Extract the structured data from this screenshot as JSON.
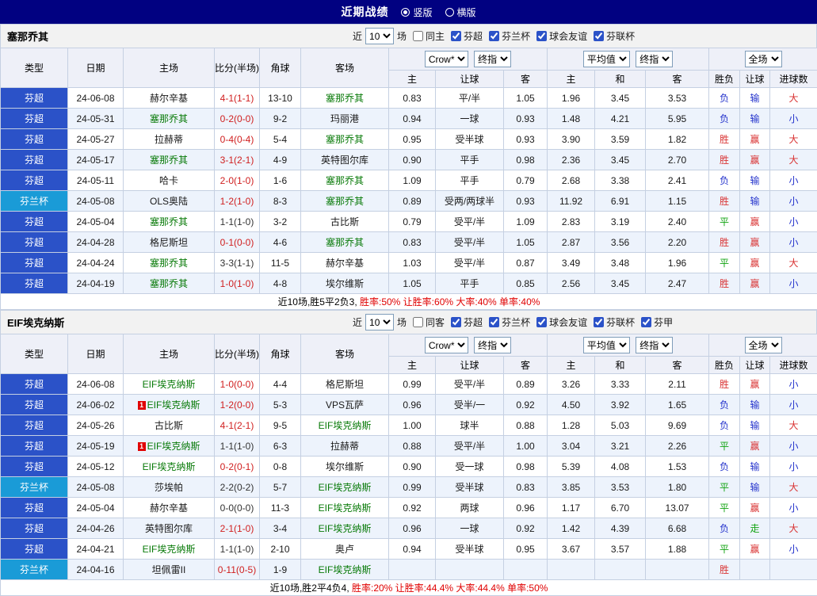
{
  "topbar": {
    "title": "近期战绩",
    "options": [
      {
        "label": "竖版",
        "selected": true
      },
      {
        "label": "横版",
        "selected": false
      }
    ]
  },
  "filter_labels": {
    "near": "近",
    "count": "10",
    "games": "场"
  },
  "odds_groups": {
    "book_select": "Crow*",
    "final_select": "终指",
    "avg_select": "平均值",
    "avg_final_select": "终指",
    "full_select": "全场"
  },
  "columns": {
    "type": "类型",
    "date": "日期",
    "home": "主场",
    "score": "比分(半场)",
    "corner": "角球",
    "away": "客场",
    "home_odds": "主",
    "handicap": "让球",
    "away_odds": "客",
    "avg_home": "主",
    "avg_draw": "和",
    "avg_away": "客",
    "result": "胜负",
    "handicap_result": "让球",
    "goals": "进球数"
  },
  "colors": {
    "topbar_bg": "#010181",
    "league_super": "#2b52c8",
    "league_cup": "#1a9bd7",
    "focus_team": "#087a08",
    "score_red": "#d02020",
    "score_dark": "#333333",
    "result_win": "#d93333",
    "result_draw": "#12a312",
    "result_lose": "#2433cc",
    "summary_stats": "#e00000",
    "red_card": "#e00000"
  },
  "sections": [
    {
      "team": "塞那乔其",
      "same_filter": "同主",
      "same_checked": false,
      "leagues": [
        {
          "label": "芬超",
          "checked": true
        },
        {
          "label": "芬兰杯",
          "checked": true
        },
        {
          "label": "球会友谊",
          "checked": true
        },
        {
          "label": "芬联杯",
          "checked": true
        }
      ],
      "summary_prefix": "近10场,胜5平2负3, ",
      "summary_stats": "胜率:50% 让胜率:60% 大率:40% 单率:40%",
      "rows": [
        {
          "league": "芬超",
          "league_type": "super",
          "date": "24-06-08",
          "home": "赫尔辛基",
          "home_focus": false,
          "home_redcard": "",
          "score": "4-1(1-1)",
          "score_style": "red",
          "corner": "13-10",
          "away": "塞那乔其",
          "away_focus": true,
          "odds": [
            "0.83",
            "平/半",
            "1.05",
            "1.96",
            "3.45",
            "3.53"
          ],
          "result": {
            "text": "负",
            "style": "lose"
          },
          "handicap_result": {
            "text": "输",
            "style": "lose"
          },
          "goals": {
            "text": "大",
            "style": "win"
          }
        },
        {
          "league": "芬超",
          "league_type": "super",
          "date": "24-05-31",
          "home": "塞那乔其",
          "home_focus": true,
          "home_redcard": "",
          "score": "0-2(0-0)",
          "score_style": "red",
          "corner": "9-2",
          "away": "玛丽港",
          "away_focus": false,
          "odds": [
            "0.94",
            "一球",
            "0.93",
            "1.48",
            "4.21",
            "5.95"
          ],
          "result": {
            "text": "负",
            "style": "lose"
          },
          "handicap_result": {
            "text": "输",
            "style": "lose"
          },
          "goals": {
            "text": "小",
            "style": "lose"
          }
        },
        {
          "league": "芬超",
          "league_type": "super",
          "date": "24-05-27",
          "home": "拉赫蒂",
          "home_focus": false,
          "home_redcard": "",
          "score": "0-4(0-4)",
          "score_style": "red",
          "corner": "5-4",
          "away": "塞那乔其",
          "away_focus": true,
          "odds": [
            "0.95",
            "受半球",
            "0.93",
            "3.90",
            "3.59",
            "1.82"
          ],
          "result": {
            "text": "胜",
            "style": "win"
          },
          "handicap_result": {
            "text": "赢",
            "style": "win"
          },
          "goals": {
            "text": "大",
            "style": "win"
          }
        },
        {
          "league": "芬超",
          "league_type": "super",
          "date": "24-05-17",
          "home": "塞那乔其",
          "home_focus": true,
          "home_redcard": "",
          "score": "3-1(2-1)",
          "score_style": "red",
          "corner": "4-9",
          "away": "英特图尔库",
          "away_focus": false,
          "odds": [
            "0.90",
            "平手",
            "0.98",
            "2.36",
            "3.45",
            "2.70"
          ],
          "result": {
            "text": "胜",
            "style": "win"
          },
          "handicap_result": {
            "text": "赢",
            "style": "win"
          },
          "goals": {
            "text": "大",
            "style": "win"
          }
        },
        {
          "league": "芬超",
          "league_type": "super",
          "date": "24-05-11",
          "home": "哈卡",
          "home_focus": false,
          "home_redcard": "",
          "score": "2-0(1-0)",
          "score_style": "red",
          "corner": "1-6",
          "away": "塞那乔其",
          "away_focus": true,
          "odds": [
            "1.09",
            "平手",
            "0.79",
            "2.68",
            "3.38",
            "2.41"
          ],
          "result": {
            "text": "负",
            "style": "lose"
          },
          "handicap_result": {
            "text": "输",
            "style": "lose"
          },
          "goals": {
            "text": "小",
            "style": "lose"
          }
        },
        {
          "league": "芬兰杯",
          "league_type": "cup",
          "date": "24-05-08",
          "home": "OLS奥陆",
          "home_focus": false,
          "home_redcard": "",
          "score": "1-2(1-0)",
          "score_style": "red",
          "corner": "8-3",
          "away": "塞那乔其",
          "away_focus": true,
          "odds": [
            "0.89",
            "受两/两球半",
            "0.93",
            "11.92",
            "6.91",
            "1.15"
          ],
          "result": {
            "text": "胜",
            "style": "win"
          },
          "handicap_result": {
            "text": "输",
            "style": "lose"
          },
          "goals": {
            "text": "小",
            "style": "lose"
          }
        },
        {
          "league": "芬超",
          "league_type": "super",
          "date": "24-05-04",
          "home": "塞那乔其",
          "home_focus": true,
          "home_redcard": "",
          "score": "1-1(1-0)",
          "score_style": "dark",
          "corner": "3-2",
          "away": "古比斯",
          "away_focus": false,
          "odds": [
            "0.79",
            "受平/半",
            "1.09",
            "2.83",
            "3.19",
            "2.40"
          ],
          "result": {
            "text": "平",
            "style": "draw"
          },
          "handicap_result": {
            "text": "赢",
            "style": "win"
          },
          "goals": {
            "text": "小",
            "style": "lose"
          }
        },
        {
          "league": "芬超",
          "league_type": "super",
          "date": "24-04-28",
          "home": "格尼斯坦",
          "home_focus": false,
          "home_redcard": "",
          "score": "0-1(0-0)",
          "score_style": "red",
          "corner": "4-6",
          "away": "塞那乔其",
          "away_focus": true,
          "odds": [
            "0.83",
            "受平/半",
            "1.05",
            "2.87",
            "3.56",
            "2.20"
          ],
          "result": {
            "text": "胜",
            "style": "win"
          },
          "handicap_result": {
            "text": "赢",
            "style": "win"
          },
          "goals": {
            "text": "小",
            "style": "lose"
          }
        },
        {
          "league": "芬超",
          "league_type": "super",
          "date": "24-04-24",
          "home": "塞那乔其",
          "home_focus": true,
          "home_redcard": "",
          "score": "3-3(1-1)",
          "score_style": "dark",
          "corner": "11-5",
          "away": "赫尔辛基",
          "away_focus": false,
          "odds": [
            "1.03",
            "受平/半",
            "0.87",
            "3.49",
            "3.48",
            "1.96"
          ],
          "result": {
            "text": "平",
            "style": "draw"
          },
          "handicap_result": {
            "text": "赢",
            "style": "win"
          },
          "goals": {
            "text": "大",
            "style": "win"
          }
        },
        {
          "league": "芬超",
          "league_type": "super",
          "date": "24-04-19",
          "home": "塞那乔其",
          "home_focus": true,
          "home_redcard": "",
          "score": "1-0(1-0)",
          "score_style": "red",
          "corner": "4-8",
          "away": "埃尔维斯",
          "away_focus": false,
          "odds": [
            "1.05",
            "平手",
            "0.85",
            "2.56",
            "3.45",
            "2.47"
          ],
          "result": {
            "text": "胜",
            "style": "win"
          },
          "handicap_result": {
            "text": "赢",
            "style": "win"
          },
          "goals": {
            "text": "小",
            "style": "lose"
          }
        }
      ]
    },
    {
      "team": "EIF埃克纳斯",
      "same_filter": "同客",
      "same_checked": false,
      "leagues": [
        {
          "label": "芬超",
          "checked": true
        },
        {
          "label": "芬兰杯",
          "checked": true
        },
        {
          "label": "球会友谊",
          "checked": true
        },
        {
          "label": "芬联杯",
          "checked": true
        },
        {
          "label": "芬甲",
          "checked": true
        }
      ],
      "summary_prefix": "近10场,胜2平4负4, ",
      "summary_stats": "胜率:20% 让胜率:44.4% 大率:44.4% 单率:50%",
      "rows": [
        {
          "league": "芬超",
          "league_type": "super",
          "date": "24-06-08",
          "home": "EIF埃克纳斯",
          "home_focus": true,
          "home_redcard": "",
          "score": "1-0(0-0)",
          "score_style": "red",
          "corner": "4-4",
          "away": "格尼斯坦",
          "away_focus": false,
          "odds": [
            "0.99",
            "受平/半",
            "0.89",
            "3.26",
            "3.33",
            "2.11"
          ],
          "result": {
            "text": "胜",
            "style": "win"
          },
          "handicap_result": {
            "text": "赢",
            "style": "win"
          },
          "goals": {
            "text": "小",
            "style": "lose"
          }
        },
        {
          "league": "芬超",
          "league_type": "super",
          "date": "24-06-02",
          "home": "EIF埃克纳斯",
          "home_focus": true,
          "home_redcard": "1",
          "score": "1-2(0-0)",
          "score_style": "red",
          "corner": "5-3",
          "away": "VPS瓦萨",
          "away_focus": false,
          "odds": [
            "0.96",
            "受半/一",
            "0.92",
            "4.50",
            "3.92",
            "1.65"
          ],
          "result": {
            "text": "负",
            "style": "lose"
          },
          "handicap_result": {
            "text": "输",
            "style": "lose"
          },
          "goals": {
            "text": "小",
            "style": "lose"
          }
        },
        {
          "league": "芬超",
          "league_type": "super",
          "date": "24-05-26",
          "home": "古比斯",
          "home_focus": false,
          "home_redcard": "",
          "score": "4-1(2-1)",
          "score_style": "red",
          "corner": "9-5",
          "away": "EIF埃克纳斯",
          "away_focus": true,
          "odds": [
            "1.00",
            "球半",
            "0.88",
            "1.28",
            "5.03",
            "9.69"
          ],
          "result": {
            "text": "负",
            "style": "lose"
          },
          "handicap_result": {
            "text": "输",
            "style": "lose"
          },
          "goals": {
            "text": "大",
            "style": "win"
          }
        },
        {
          "league": "芬超",
          "league_type": "super",
          "date": "24-05-19",
          "home": "EIF埃克纳斯",
          "home_focus": true,
          "home_redcard": "1",
          "score": "1-1(1-0)",
          "score_style": "dark",
          "corner": "6-3",
          "away": "拉赫蒂",
          "away_focus": false,
          "odds": [
            "0.88",
            "受平/半",
            "1.00",
            "3.04",
            "3.21",
            "2.26"
          ],
          "result": {
            "text": "平",
            "style": "draw"
          },
          "handicap_result": {
            "text": "赢",
            "style": "win"
          },
          "goals": {
            "text": "小",
            "style": "lose"
          }
        },
        {
          "league": "芬超",
          "league_type": "super",
          "date": "24-05-12",
          "home": "EIF埃克纳斯",
          "home_focus": true,
          "home_redcard": "",
          "score": "0-2(0-1)",
          "score_style": "red",
          "corner": "0-8",
          "away": "埃尔维斯",
          "away_focus": false,
          "odds": [
            "0.90",
            "受一球",
            "0.98",
            "5.39",
            "4.08",
            "1.53"
          ],
          "result": {
            "text": "负",
            "style": "lose"
          },
          "handicap_result": {
            "text": "输",
            "style": "lose"
          },
          "goals": {
            "text": "小",
            "style": "lose"
          }
        },
        {
          "league": "芬兰杯",
          "league_type": "cup",
          "date": "24-05-08",
          "home": "莎埃帕",
          "home_focus": false,
          "home_redcard": "",
          "score": "2-2(0-2)",
          "score_style": "dark",
          "corner": "5-7",
          "away": "EIF埃克纳斯",
          "away_focus": true,
          "odds": [
            "0.99",
            "受半球",
            "0.83",
            "3.85",
            "3.53",
            "1.80"
          ],
          "result": {
            "text": "平",
            "style": "draw"
          },
          "handicap_result": {
            "text": "输",
            "style": "lose"
          },
          "goals": {
            "text": "大",
            "style": "win"
          }
        },
        {
          "league": "芬超",
          "league_type": "super",
          "date": "24-05-04",
          "home": "赫尔辛基",
          "home_focus": false,
          "home_redcard": "",
          "score": "0-0(0-0)",
          "score_style": "dark",
          "corner": "11-3",
          "away": "EIF埃克纳斯",
          "away_focus": true,
          "odds": [
            "0.92",
            "两球",
            "0.96",
            "1.17",
            "6.70",
            "13.07"
          ],
          "result": {
            "text": "平",
            "style": "draw"
          },
          "handicap_result": {
            "text": "赢",
            "style": "win"
          },
          "goals": {
            "text": "小",
            "style": "lose"
          }
        },
        {
          "league": "芬超",
          "league_type": "super",
          "date": "24-04-26",
          "home": "英特图尔库",
          "home_focus": false,
          "home_redcard": "",
          "score": "2-1(1-0)",
          "score_style": "red",
          "corner": "3-4",
          "away": "EIF埃克纳斯",
          "away_focus": true,
          "odds": [
            "0.96",
            "一球",
            "0.92",
            "1.42",
            "4.39",
            "6.68"
          ],
          "result": {
            "text": "负",
            "style": "lose"
          },
          "handicap_result": {
            "text": "走",
            "style": "draw"
          },
          "goals": {
            "text": "大",
            "style": "win"
          }
        },
        {
          "league": "芬超",
          "league_type": "super",
          "date": "24-04-21",
          "home": "EIF埃克纳斯",
          "home_focus": true,
          "home_redcard": "",
          "score": "1-1(1-0)",
          "score_style": "dark",
          "corner": "2-10",
          "away": "奥卢",
          "away_focus": false,
          "odds": [
            "0.94",
            "受半球",
            "0.95",
            "3.67",
            "3.57",
            "1.88"
          ],
          "result": {
            "text": "平",
            "style": "draw"
          },
          "handicap_result": {
            "text": "赢",
            "style": "win"
          },
          "goals": {
            "text": "小",
            "style": "lose"
          }
        },
        {
          "league": "芬兰杯",
          "league_type": "cup",
          "date": "24-04-16",
          "home": "坦佩雷II",
          "home_focus": false,
          "home_redcard": "",
          "score": "0-11(0-5)",
          "score_style": "red",
          "corner": "1-9",
          "away": "EIF埃克纳斯",
          "away_focus": true,
          "odds": [
            "",
            "",
            "",
            "",
            "",
            ""
          ],
          "result": {
            "text": "胜",
            "style": "win"
          },
          "handicap_result": null,
          "goals": null
        }
      ]
    }
  ]
}
